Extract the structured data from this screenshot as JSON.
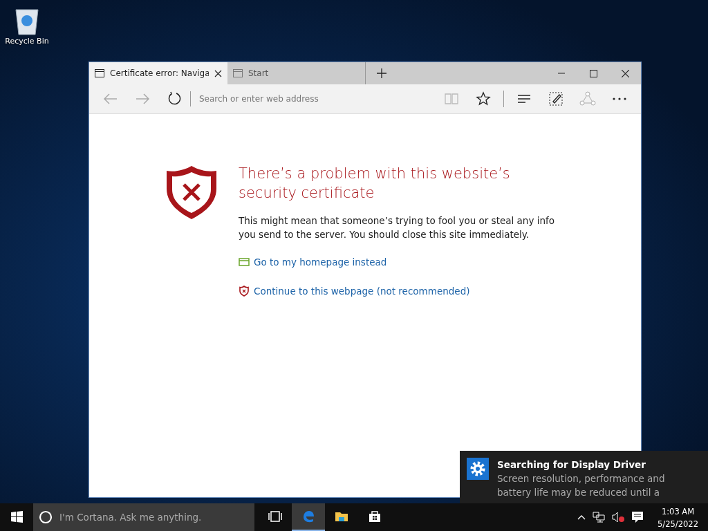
{
  "desktop_icons": [
    {
      "label": "Recycle Bin"
    }
  ],
  "browser": {
    "tabs": [
      {
        "title": "Certificate error: Naviga",
        "selected": true
      },
      {
        "title": "Start",
        "selected": false
      }
    ],
    "address_placeholder": "Search or enter web address",
    "page": {
      "heading": "There’s a problem with this website’s security certificate",
      "message": "This might mean that someone’s trying to fool you or steal any info you send to the server. You should close this site immediately.",
      "links": [
        {
          "kind": "home",
          "text": "Go to my homepage instead"
        },
        {
          "kind": "continue",
          "text": "Continue to this webpage (not recommended)"
        }
      ]
    }
  },
  "notification": {
    "title": "Searching for Display Driver",
    "body": "Screen resolution, performance and battery life may be reduced until a"
  },
  "taskbar": {
    "search_placeholder": "I'm Cortana. Ask me anything.",
    "apps": [
      {
        "kind": "taskview",
        "selected": false
      },
      {
        "kind": "edge",
        "selected": true
      },
      {
        "kind": "explorer",
        "selected": false
      },
      {
        "kind": "store",
        "selected": false
      }
    ],
    "time": "1:03 AM",
    "date": "5/25/2022"
  }
}
